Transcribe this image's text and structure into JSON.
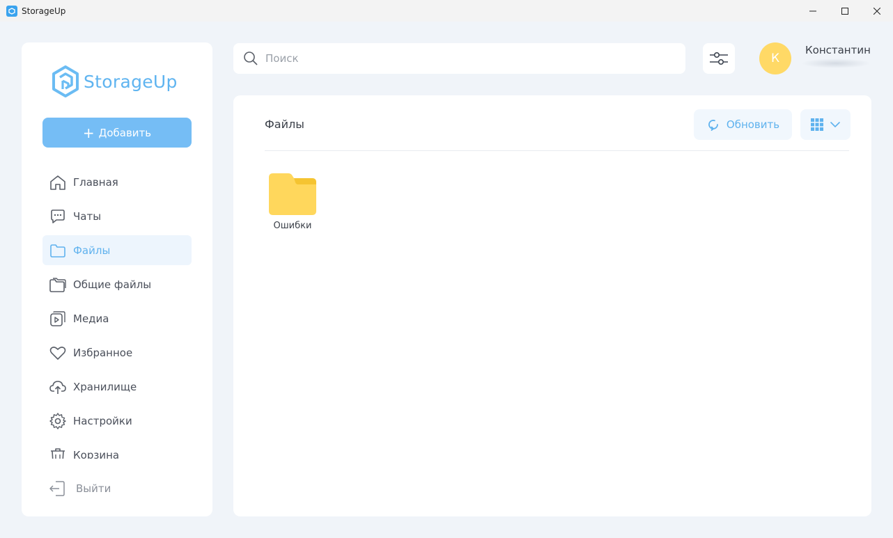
{
  "window": {
    "title": "StorageUp"
  },
  "sidebar": {
    "logo_text": "StorageUp",
    "add_label": "Добавить",
    "items": [
      {
        "label": "Главная",
        "icon": "home-icon",
        "active": false
      },
      {
        "label": "Чаты",
        "icon": "chat-icon",
        "active": false
      },
      {
        "label": "Файлы",
        "icon": "folder-icon",
        "active": true
      },
      {
        "label": "Общие файлы",
        "icon": "shared-folder-icon",
        "active": false
      },
      {
        "label": "Медиа",
        "icon": "media-icon",
        "active": false
      },
      {
        "label": "Избранное",
        "icon": "heart-icon",
        "active": false
      },
      {
        "label": "Хранилище",
        "icon": "cloud-upload-icon",
        "active": false
      },
      {
        "label": "Настройки",
        "icon": "gear-icon",
        "active": false
      },
      {
        "label": "Корзина",
        "icon": "trash-icon",
        "active": false
      }
    ],
    "logout_label": "Выйти"
  },
  "header": {
    "search_placeholder": "Поиск",
    "search_value": "",
    "user_initial": "К",
    "user_name": "Константин"
  },
  "main": {
    "title": "Файлы",
    "refresh_label": "Обновить",
    "folders": [
      {
        "name": "Ошибки"
      }
    ]
  },
  "colors": {
    "accent": "#60b2ee",
    "add_button": "#75bdf5",
    "avatar": "#ffd966",
    "folder": "#ffd75c"
  }
}
